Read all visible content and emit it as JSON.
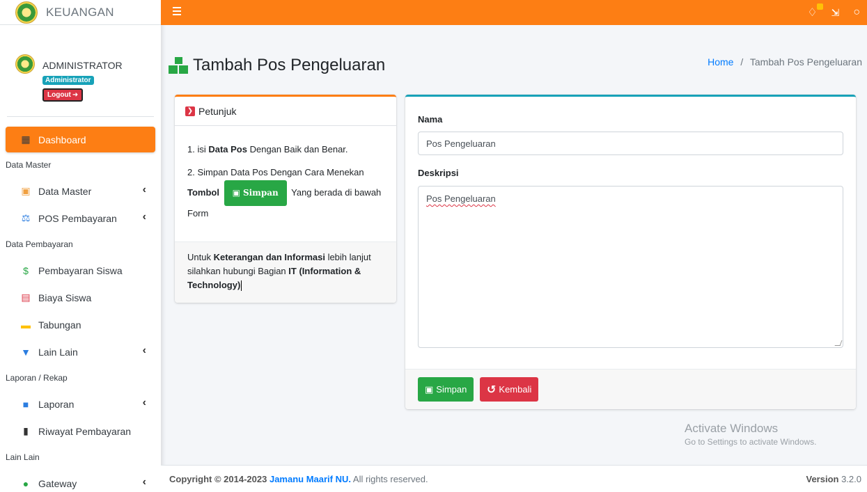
{
  "brand": {
    "title": "KEUANGAN"
  },
  "user": {
    "name": "ADMINISTRATOR",
    "role": "Administrator",
    "logout_label": "Logout"
  },
  "sidebar": {
    "items": [
      {
        "type": "item",
        "label": "Dashboard",
        "icon": "grid-icon",
        "active": true
      },
      {
        "type": "header",
        "label": "Data Master"
      },
      {
        "type": "item",
        "label": "Data Master",
        "icon": "boxes-icon",
        "chevron": true
      },
      {
        "type": "item",
        "label": "POS Pembayaran",
        "icon": "balance-scale-icon",
        "chevron": true
      },
      {
        "type": "header",
        "label": "Data Pembayaran"
      },
      {
        "type": "item",
        "label": "Pembayaran Siswa",
        "icon": "dollar-circle-icon"
      },
      {
        "type": "item",
        "label": "Biaya Siswa",
        "icon": "invoice-icon"
      },
      {
        "type": "item",
        "label": "Tabungan",
        "icon": "wallet-icon"
      },
      {
        "type": "item",
        "label": "Lain Lain",
        "icon": "funnel-dollar-icon",
        "chevron": true
      },
      {
        "type": "header",
        "label": "Laporan / Rekap"
      },
      {
        "type": "item",
        "label": "Laporan",
        "icon": "copy-icon",
        "chevron": true
      },
      {
        "type": "item",
        "label": "Riwayat Pembayaran",
        "icon": "clipboard-icon"
      },
      {
        "type": "header",
        "label": "Lain Lain"
      },
      {
        "type": "item",
        "label": "Gateway",
        "icon": "money-bill-icon",
        "chevron": true
      }
    ]
  },
  "page": {
    "title": "Tambah Pos Pengeluaran"
  },
  "breadcrumb": {
    "home": "Home",
    "separator": "/",
    "current": "Tambah Pos Pengeluaran"
  },
  "help": {
    "title": "Petunjuk",
    "step1_pre": "1. isi ",
    "step1_bold": "Data Pos",
    "step1_post": " Dengan Baik dan Benar.",
    "step2_pre": "2. Simpan Data Pos Dengan Cara Menekan ",
    "step2_bold": "Tombol",
    "step2_button": "Simpan",
    "step2_post": " Yang berada di bawah Form",
    "footer_pre": "Untuk ",
    "footer_bold1": "Keterangan dan Informasi",
    "footer_mid": " lebih lanjut silahkan hubungi Bagian ",
    "footer_bold2": "IT (Information & Technology)"
  },
  "form": {
    "name_label": "Nama",
    "name_value": "Pos Pengeluaran",
    "desc_label": "Deskripsi",
    "desc_value": "Pos Pengeluaran",
    "save_label": "Simpan",
    "back_label": "Kembali"
  },
  "watermark": {
    "line1": "Activate Windows",
    "line2": "Go to Settings to activate Windows."
  },
  "footer": {
    "copyright_pre": "Copyright © 2014-2023 ",
    "company": "Jamanu Maarif NU.",
    "rights": " All rights reserved.",
    "version_label": "Version",
    "version": "3.2.0"
  },
  "colors": {
    "primary": "#fd7e14",
    "success": "#28a745",
    "danger": "#dc3545",
    "info": "#17a2b8",
    "link": "#007bff"
  }
}
